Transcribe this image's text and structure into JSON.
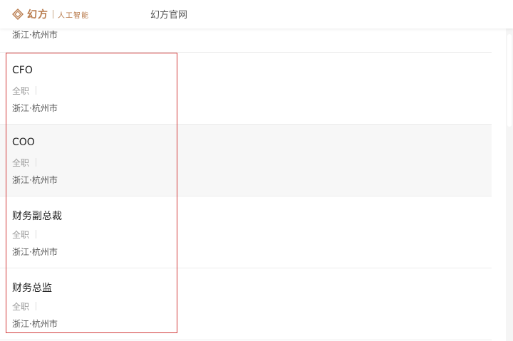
{
  "header": {
    "logo_text": "幻方",
    "logo_sub": "人工智能",
    "nav_link": "幻方官网",
    "brand_color": "#b87a4b"
  },
  "jobs": [
    {
      "title": "",
      "type": "",
      "location": "浙江·杭州市"
    },
    {
      "title": "CFO",
      "type": "全职",
      "location": "浙江·杭州市"
    },
    {
      "title": "COO",
      "type": "全职",
      "location": "浙江·杭州市"
    },
    {
      "title": "财务副总裁",
      "type": "全职",
      "location": "浙江·杭州市"
    },
    {
      "title": "财务总监",
      "type": "全职",
      "location": "浙江·杭州市"
    }
  ],
  "highlight_color": "#d23a3a"
}
